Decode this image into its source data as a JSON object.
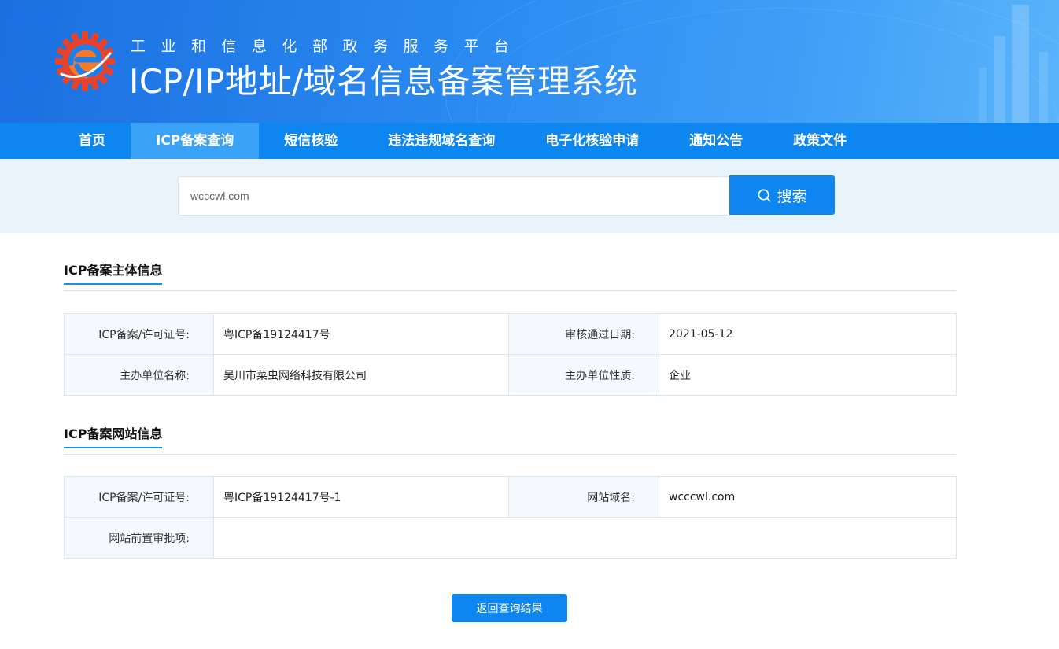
{
  "header": {
    "subtitle": "工业和信息化部政务服务平台",
    "title": "ICP/IP地址/域名信息备案管理系统",
    "logo_icon": "miit-gear-e-logo"
  },
  "nav": {
    "items": [
      {
        "label": "首页",
        "active": false
      },
      {
        "label": "ICP备案查询",
        "active": true
      },
      {
        "label": "短信核验",
        "active": false
      },
      {
        "label": "违法违规域名查询",
        "active": false
      },
      {
        "label": "电子化核验申请",
        "active": false
      },
      {
        "label": "通知公告",
        "active": false
      },
      {
        "label": "政策文件",
        "active": false
      }
    ]
  },
  "search": {
    "value": "wcccwl.com",
    "button_label": "搜索",
    "button_icon": "search-icon"
  },
  "subject_section": {
    "title": "ICP备案主体信息",
    "rows": [
      {
        "label1": "ICP备案/许可证号:",
        "value1": "粤ICP备19124417号",
        "label2": "审核通过日期:",
        "value2": "2021-05-12"
      },
      {
        "label1": "主办单位名称:",
        "value1": "吴川市菜虫网络科技有限公司",
        "label2": "主办单位性质:",
        "value2": "企业"
      }
    ]
  },
  "website_section": {
    "title": "ICP备案网站信息",
    "row1": {
      "label1": "ICP备案/许可证号:",
      "value1": "粤ICP备19124417号-1",
      "label2": "网站域名:",
      "value2": "wcccwl.com"
    },
    "row2": {
      "label": "网站前置审批项:",
      "value": ""
    }
  },
  "back_button_label": "返回查询结果",
  "colors": {
    "primary": "#0d86f0",
    "nav_active": "#3aa3f7",
    "search_band": "#e8f3fc",
    "label_bg": "#f4f9fd"
  }
}
